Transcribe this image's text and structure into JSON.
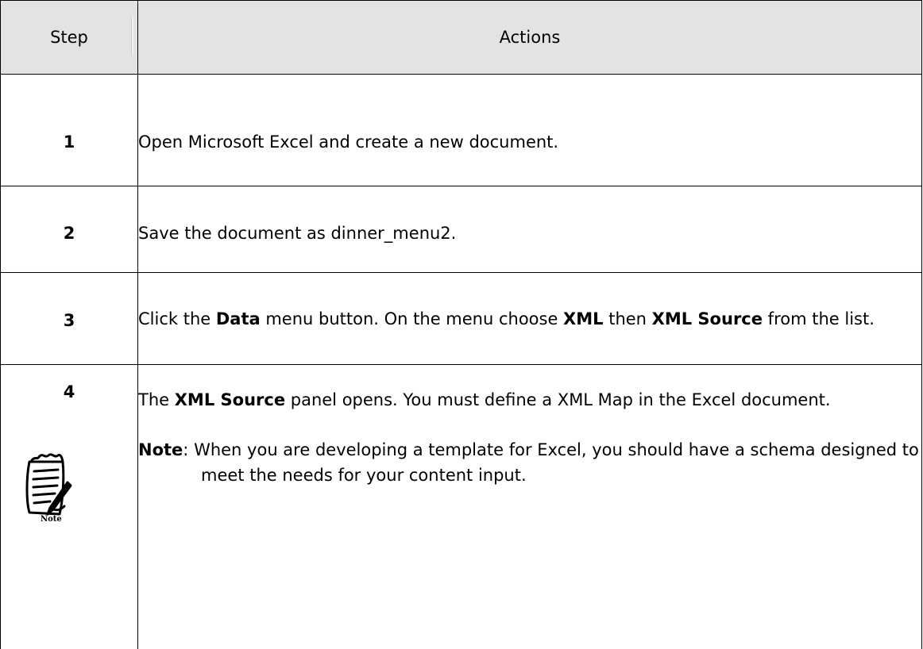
{
  "header": {
    "step": "Step",
    "actions": "Actions"
  },
  "rows": [
    {
      "num": "1",
      "text": "Open Microsoft Excel and create a new document."
    },
    {
      "num": "2",
      "text": "Save the document as dinner_menu2."
    },
    {
      "num": "3",
      "pre": "Click the ",
      "b1": "Data",
      "mid1": " menu button. On the menu choose ",
      "b2": "XML",
      "mid2": " then ",
      "b3": "XML Source",
      "post": " from the list."
    },
    {
      "num": "4",
      "pre": "The ",
      "b1": "XML Source",
      "post": " panel opens. You must define a XML Map in the Excel document.",
      "note_label": "Note",
      "note_colon": ": ",
      "note_text": "When you are developing a template for Excel, you should have a schema designed to meet the needs for your content input.",
      "icon_label": "Note"
    }
  ],
  "icon": "note-pad-icon"
}
